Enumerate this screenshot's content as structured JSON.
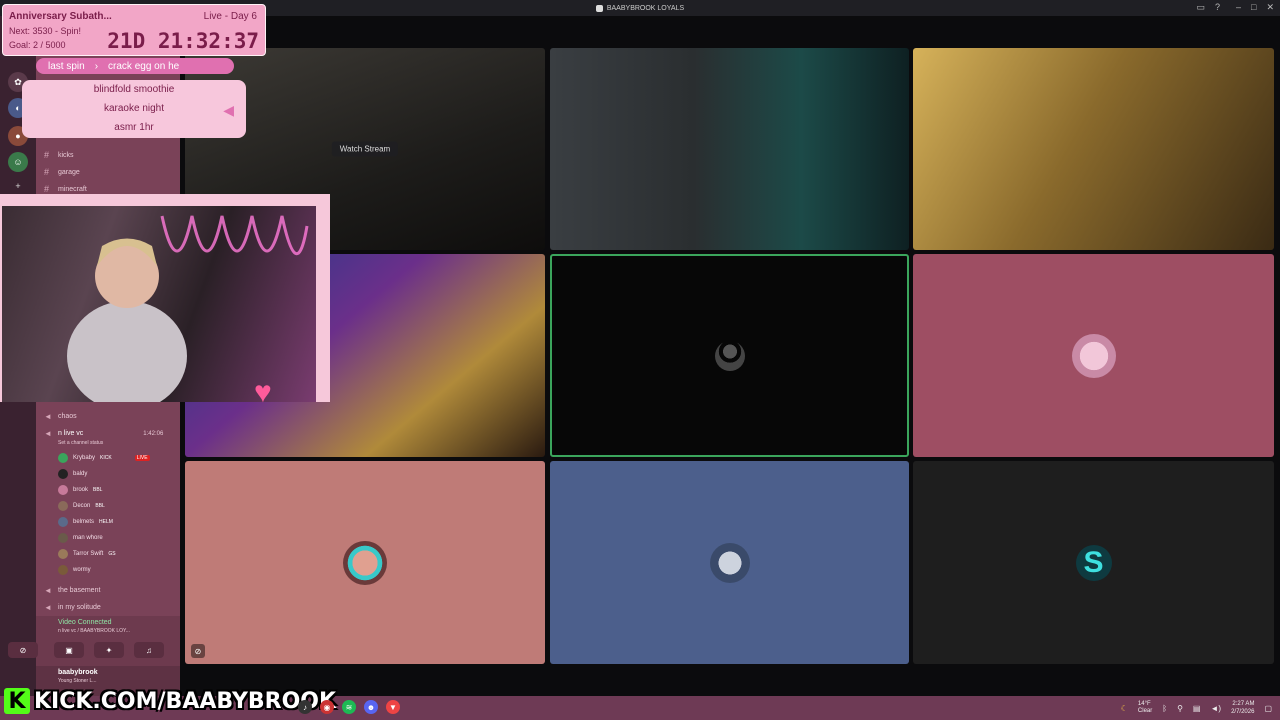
{
  "window": {
    "title": "BAABYBROOK LOYALS"
  },
  "subathon": {
    "title": "Anniversary Subath...",
    "day": "Live - Day 6",
    "next": "Next: 3530 - Spin!",
    "goal": "Goal: 2 / 5000",
    "timer": "21D 21:32:37"
  },
  "spin": {
    "last_label": "last spin",
    "last_value": "crack egg on he",
    "options": [
      "blindfold smoothie",
      "karaoke night",
      "asmr 1hr"
    ]
  },
  "channels": [
    {
      "type": "text",
      "name": "kicks"
    },
    {
      "type": "text",
      "name": "garage"
    },
    {
      "type": "text",
      "name": "minecraft"
    },
    {
      "type": "voice",
      "name": "chaos"
    },
    {
      "type": "voice",
      "name": "n live vc",
      "timer": "1:42:06",
      "status": "Set a channel status"
    },
    {
      "type": "voice",
      "name": "the basement"
    },
    {
      "type": "voice",
      "name": "in my solitude"
    }
  ],
  "members": [
    {
      "name": "Krybaby",
      "tag": "KICK",
      "live": "LIVE",
      "color": "#3aa55c"
    },
    {
      "name": "baldy",
      "tag": "",
      "live": "",
      "color": "#222222"
    },
    {
      "name": "brook",
      "tag": "BBL",
      "live": "",
      "color": "#c77a9a"
    },
    {
      "name": "Decon",
      "tag": "BBL",
      "live": "",
      "color": "#8a6a5a"
    },
    {
      "name": "belmets",
      "tag": "HELM",
      "live": "",
      "color": "#5a6a8a"
    },
    {
      "name": "man whore",
      "tag": "",
      "live": "",
      "color": "#6a5a4a"
    },
    {
      "name": "Tarror Swift",
      "tag": "GS",
      "live": "",
      "color": "#9a7a5a"
    },
    {
      "name": "wormy",
      "tag": "",
      "live": "",
      "color": "#7a5a3a"
    }
  ],
  "voice_panel": {
    "status": "Video Connected",
    "channel": "n live vc / BAABYBROOK LOY...",
    "username": "baabybrook",
    "user_status": "Young Stoner L..."
  },
  "tiles": {
    "watch_stream": "Watch Stream"
  },
  "colors": {
    "tile_pink": "#9e4e63",
    "tile_salmon": "#bf7b77",
    "tile_slate": "#4c5f8c",
    "tile_dark": "#1e1e1e",
    "tile_black": "#070707",
    "speaking_border": "#3ba55c"
  },
  "kick_banner": "KICK.COM/BAABYBROOK",
  "tray": {
    "weather_temp": "14°F",
    "weather_desc": "Clear",
    "time": "2:27 AM",
    "date": "2/7/2026"
  }
}
